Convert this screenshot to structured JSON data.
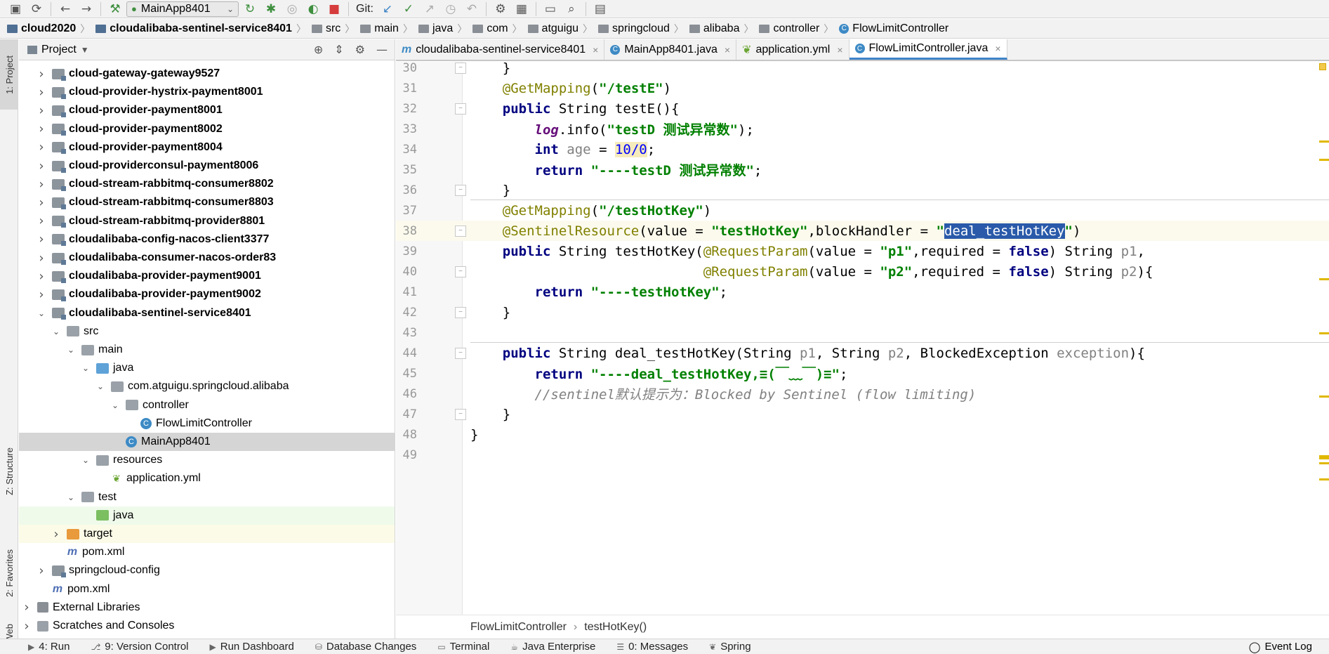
{
  "toolbar": {
    "run_config": "MainApp8401",
    "git_label": "Git:",
    "buttons": [
      "save-all-icon",
      "sync-icon",
      "back-icon",
      "forward-icon",
      "build-hammer-icon",
      "rerun-icon",
      "debug-icon",
      "coverage-icon",
      "profile-icon",
      "stop-icon",
      "git-update-icon",
      "git-commit-icon",
      "git-push-icon",
      "history-icon",
      "revert-icon",
      "settings-wrench-icon",
      "project-structure-icon",
      "terminal-icon",
      "search-icon",
      "tasks-icon"
    ]
  },
  "breadcrumb": [
    "cloud2020",
    "cloudalibaba-sentinel-service8401",
    "src",
    "main",
    "java",
    "com",
    "atguigu",
    "springcloud",
    "alibaba",
    "controller",
    "FlowLimitController"
  ],
  "left_stripe": {
    "project": "1: Project",
    "structure": "Z: Structure",
    "favorites": "2: Favorites",
    "web": "Web"
  },
  "project_panel": {
    "title": "Project",
    "tree": [
      {
        "label": "cloud-gateway-gateway9527",
        "bold": true,
        "arrow": "right",
        "icon": "module"
      },
      {
        "label": "cloud-provider-hystrix-payment8001",
        "bold": true,
        "arrow": "right",
        "icon": "module"
      },
      {
        "label": "cloud-provider-payment8001",
        "bold": true,
        "arrow": "right",
        "icon": "module"
      },
      {
        "label": "cloud-provider-payment8002",
        "bold": true,
        "arrow": "right",
        "icon": "module"
      },
      {
        "label": "cloud-provider-payment8004",
        "bold": true,
        "arrow": "right",
        "icon": "module"
      },
      {
        "label": "cloud-providerconsul-payment8006",
        "bold": true,
        "arrow": "right",
        "icon": "module"
      },
      {
        "label": "cloud-stream-rabbitmq-consumer8802",
        "bold": true,
        "arrow": "right",
        "icon": "module"
      },
      {
        "label": "cloud-stream-rabbitmq-consumer8803",
        "bold": true,
        "arrow": "right",
        "icon": "module"
      },
      {
        "label": "cloud-stream-rabbitmq-provider8801",
        "bold": true,
        "arrow": "right",
        "icon": "module"
      },
      {
        "label": "cloudalibaba-config-nacos-client3377",
        "bold": true,
        "arrow": "right",
        "icon": "module"
      },
      {
        "label": "cloudalibaba-consumer-nacos-order83",
        "bold": true,
        "arrow": "right",
        "icon": "module"
      },
      {
        "label": "cloudalibaba-provider-payment9001",
        "bold": true,
        "arrow": "right",
        "icon": "module"
      },
      {
        "label": "cloudalibaba-provider-payment9002",
        "bold": true,
        "arrow": "right",
        "icon": "module"
      },
      {
        "label": "cloudalibaba-sentinel-service8401",
        "bold": true,
        "arrow": "down",
        "icon": "module"
      },
      {
        "label": "src",
        "bold": false,
        "arrow": "down",
        "icon": "folder"
      },
      {
        "label": "main",
        "bold": false,
        "arrow": "down",
        "icon": "folder"
      },
      {
        "label": "java",
        "bold": false,
        "arrow": "down",
        "icon": "folder-blue"
      },
      {
        "label": "com.atguigu.springcloud.alibaba",
        "bold": false,
        "arrow": "down",
        "icon": "pkg"
      },
      {
        "label": "controller",
        "bold": false,
        "arrow": "down",
        "icon": "pkg"
      },
      {
        "label": "FlowLimitController",
        "bold": false,
        "arrow": "none",
        "icon": "cls"
      },
      {
        "label": "MainApp8401",
        "bold": false,
        "arrow": "none",
        "icon": "cls"
      },
      {
        "label": "resources",
        "bold": false,
        "arrow": "down",
        "icon": "folder-res"
      },
      {
        "label": "application.yml",
        "bold": false,
        "arrow": "none",
        "icon": "yml"
      },
      {
        "label": "test",
        "bold": false,
        "arrow": "down",
        "icon": "folder"
      },
      {
        "label": "java",
        "bold": false,
        "arrow": "none",
        "icon": "folder-green"
      },
      {
        "label": "target",
        "bold": false,
        "arrow": "right",
        "icon": "folder-orange"
      },
      {
        "label": "pom.xml",
        "bold": false,
        "arrow": "none",
        "icon": "mvn"
      },
      {
        "label": "springcloud-config",
        "bold": false,
        "arrow": "right",
        "icon": "module"
      },
      {
        "label": "pom.xml",
        "bold": false,
        "arrow": "none",
        "icon": "mvn"
      },
      {
        "label": "External Libraries",
        "bold": false,
        "arrow": "right",
        "icon": "lib"
      },
      {
        "label": "Scratches and Consoles",
        "bold": false,
        "arrow": "right",
        "icon": "scratch"
      }
    ]
  },
  "editor_tabs": [
    {
      "label": "cloudalibaba-sentinel-service8401",
      "icon": "m",
      "active": false
    },
    {
      "label": "MainApp8401.java",
      "icon": "c",
      "active": false
    },
    {
      "label": "application.yml",
      "icon": "y",
      "active": false
    },
    {
      "label": "FlowLimitController.java",
      "icon": "c",
      "active": true
    }
  ],
  "editor": {
    "current_line": 38,
    "lines": [
      {
        "n": "30",
        "text": "    }"
      },
      {
        "n": "31",
        "text": "    @GetMapping(\"/testE\")"
      },
      {
        "n": "32",
        "text": "    public String testE(){"
      },
      {
        "n": "33",
        "text": "        log.info(\"testD 测试异常数\");"
      },
      {
        "n": "34",
        "text": "        int age = 10/0;"
      },
      {
        "n": "35",
        "text": "        return \"----testD 测试异常数\";"
      },
      {
        "n": "36",
        "text": "    }"
      },
      {
        "n": "37",
        "text": "    @GetMapping(\"/testHotKey\")"
      },
      {
        "n": "38",
        "text": "    @SentinelResource(value = \"testHotKey\",blockHandler = \"deal_testHotKey\")"
      },
      {
        "n": "39",
        "text": "    public String testHotKey(@RequestParam(value = \"p1\",required = false) String p1,"
      },
      {
        "n": "40",
        "text": "                             @RequestParam(value = \"p2\",required = false) String p2){"
      },
      {
        "n": "41",
        "text": "        return \"----testHotKey\";"
      },
      {
        "n": "42",
        "text": "    }"
      },
      {
        "n": "43",
        "text": ""
      },
      {
        "n": "44",
        "text": "    public String deal_testHotKey(String p1, String p2, BlockedException exception){"
      },
      {
        "n": "45",
        "text": "        return \"----deal_testHotKey,≡(￣﹏￣)≡\";"
      },
      {
        "n": "46",
        "text": "        //sentinel默认提示为：Blocked by Sentinel (flow limiting)"
      },
      {
        "n": "47",
        "text": "    }"
      },
      {
        "n": "48",
        "text": "}"
      },
      {
        "n": "49",
        "text": ""
      }
    ]
  },
  "editor_breadcrumb": [
    "FlowLimitController",
    "testHotKey()"
  ],
  "bottom_bar": {
    "tools": [
      "4: Run",
      "9: Version Control",
      "Run Dashboard",
      "Database Changes",
      "Terminal",
      "Java Enterprise",
      "0: Messages",
      "Spring"
    ],
    "event_log": "Event Log"
  }
}
